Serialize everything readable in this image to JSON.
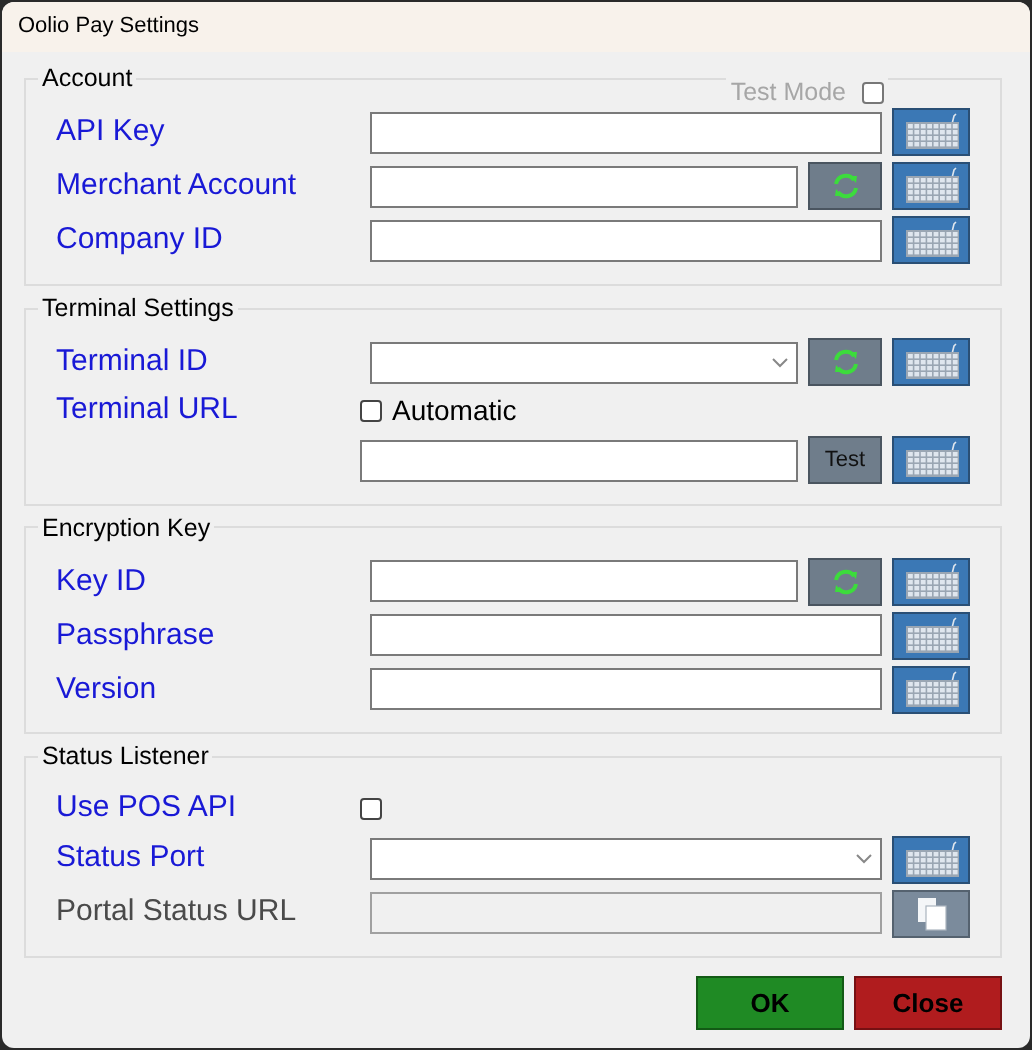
{
  "window": {
    "title": "Oolio Pay Settings"
  },
  "groups": [
    {
      "title": "Account",
      "test_mode": {
        "label": "Test Mode",
        "checked": false,
        "disabled": true
      },
      "rows": [
        {
          "kind": "text",
          "label": "API Key",
          "disabled": false,
          "buttons": [
            {
              "kind": "keyboard"
            }
          ]
        },
        {
          "kind": "text",
          "label": "Merchant Account",
          "disabled": false,
          "buttons": [
            {
              "kind": "refresh"
            },
            {
              "kind": "keyboard"
            }
          ]
        },
        {
          "kind": "text",
          "label": "Company ID",
          "disabled": false,
          "buttons": [
            {
              "kind": "keyboard"
            }
          ]
        }
      ]
    },
    {
      "title": "Terminal Settings",
      "rows": [
        {
          "kind": "dropdown",
          "label": "Terminal ID",
          "disabled": false,
          "buttons": [
            {
              "kind": "refresh"
            },
            {
              "kind": "keyboard"
            }
          ]
        },
        {
          "kind": "checkbox_text",
          "label": "Terminal URL",
          "disabled": false,
          "checkbox": {
            "label": "Automatic",
            "checked": false
          },
          "buttons": [
            {
              "kind": "test",
              "label": "Test"
            },
            {
              "kind": "keyboard"
            }
          ]
        }
      ]
    },
    {
      "title": "Encryption Key",
      "rows": [
        {
          "kind": "text",
          "label": "Key ID",
          "disabled": false,
          "buttons": [
            {
              "kind": "refresh"
            },
            {
              "kind": "keyboard"
            }
          ]
        },
        {
          "kind": "text",
          "label": "Passphrase",
          "disabled": false,
          "buttons": [
            {
              "kind": "keyboard"
            }
          ]
        },
        {
          "kind": "text",
          "label": "Version",
          "disabled": false,
          "buttons": [
            {
              "kind": "keyboard"
            }
          ]
        }
      ]
    },
    {
      "title": "Status Listener",
      "rows": [
        {
          "kind": "checkbox",
          "label": "Use POS API",
          "disabled": false,
          "checked": false
        },
        {
          "kind": "dropdown",
          "label": "Status Port",
          "disabled": false,
          "buttons": [
            {
              "kind": "keyboard"
            }
          ]
        },
        {
          "kind": "text",
          "label": "Portal Status URL",
          "disabled": true,
          "buttons": [
            {
              "kind": "copy"
            }
          ]
        }
      ]
    }
  ],
  "buttons": [
    {
      "kind": "ok",
      "label": "OK"
    },
    {
      "kind": "close",
      "label": "Close"
    }
  ]
}
